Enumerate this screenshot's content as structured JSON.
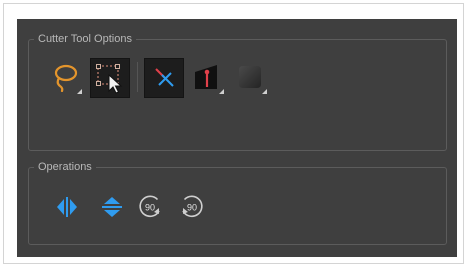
{
  "panel": {
    "tool_options_title": "Cutter Tool Options",
    "operations_title": "Operations"
  },
  "tools": [
    {
      "name": "lasso-mode",
      "icon": "lasso-icon",
      "selected": false,
      "has_submenu": true
    },
    {
      "name": "marquee-mode",
      "icon": "marquee-select-icon",
      "selected": true,
      "has_submenu": false
    },
    {
      "name": "use-mouse-gesture",
      "icon": "gesture-cut-icon",
      "selected": true,
      "has_submenu": false
    },
    {
      "name": "tip-style",
      "icon": "tip-style-icon",
      "selected": false,
      "has_submenu": true
    },
    {
      "name": "brush-swatch",
      "icon": "swatch-icon",
      "selected": false,
      "has_submenu": true
    }
  ],
  "operations": [
    {
      "name": "flip-horizontal",
      "icon": "flip-horizontal-icon"
    },
    {
      "name": "flip-vertical",
      "icon": "flip-vertical-icon"
    },
    {
      "name": "rotate-90-cw",
      "icon": "rotate-cw-icon",
      "label": "90"
    },
    {
      "name": "rotate-90-ccw",
      "icon": "rotate-ccw-icon",
      "label": "90"
    }
  ],
  "colors": {
    "panel_bg": "#3f3f3f",
    "accent_blue": "#2f9cf0",
    "lasso_orange": "#e4952c",
    "tip_red": "#e0404a"
  }
}
